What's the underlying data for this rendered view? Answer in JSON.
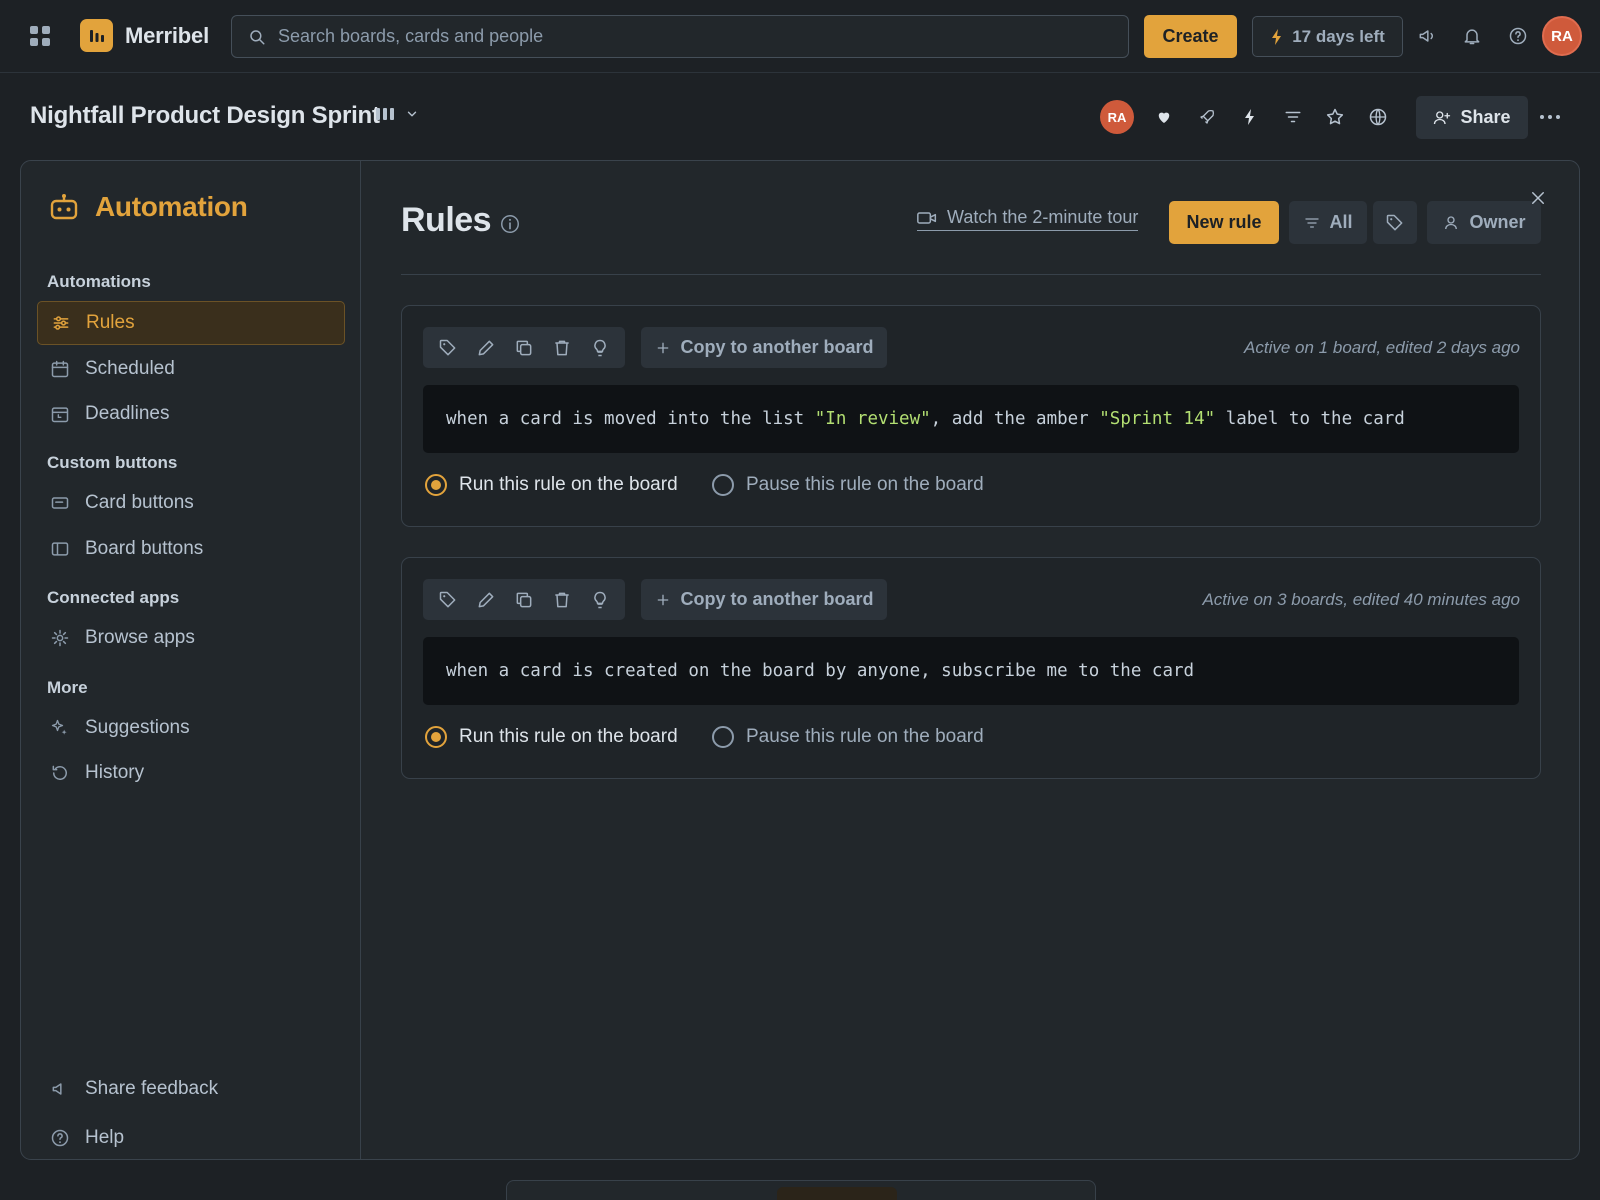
{
  "topbar": {
    "brand": "Merribel",
    "search_placeholder": "Search boards, cards and people",
    "create_label": "Create",
    "trial_label": "17 days left",
    "avatar_initials": "RA"
  },
  "board": {
    "title": "Nightfall Product Design Sprint",
    "avatar_initials": "RA",
    "share_label": "Share"
  },
  "sidebar": {
    "title": "Automation",
    "sections": [
      {
        "label": "Automations",
        "items": [
          {
            "label": "Rules",
            "icon": "sliders-icon",
            "active": true
          },
          {
            "label": "Scheduled",
            "icon": "calendar-icon"
          },
          {
            "label": "Deadlines",
            "icon": "calendar-clock-icon"
          }
        ]
      },
      {
        "label": "Custom buttons",
        "items": [
          {
            "label": "Card buttons",
            "icon": "card-icon"
          },
          {
            "label": "Board buttons",
            "icon": "board-icon"
          }
        ]
      },
      {
        "label": "Connected apps",
        "items": [
          {
            "label": "Browse apps",
            "icon": "gear-icon"
          }
        ]
      },
      {
        "label": "More",
        "items": [
          {
            "label": "Suggestions",
            "icon": "sparkle-icon"
          },
          {
            "label": "History",
            "icon": "history-icon"
          }
        ]
      }
    ],
    "footer": [
      {
        "label": "Share feedback",
        "icon": "megaphone-icon"
      },
      {
        "label": "Help",
        "icon": "help-icon"
      }
    ]
  },
  "main": {
    "title": "Rules",
    "tour_label": "Watch the 2-minute tour",
    "new_rule_label": "New rule",
    "filter_label": "All",
    "owner_label": "Owner",
    "rules": [
      {
        "copy_label": "Copy to another board",
        "meta": "Active on 1 board, edited 2 days ago",
        "code_parts": [
          "when a card is moved into the list ",
          "\"In review\"",
          ", add the amber ",
          "\"Sprint 14\"",
          " label to the card"
        ],
        "run_label": "Run this rule on the board",
        "pause_label": "Pause this rule on the board",
        "running": true
      },
      {
        "copy_label": "Copy to another board",
        "meta": "Active on 3 boards, edited 40 minutes ago",
        "code_parts": [
          "when a card is created on the board by anyone, subscribe me to the card"
        ],
        "run_label": "Run this rule on the board",
        "pause_label": "Pause this rule on the board",
        "running": true
      }
    ]
  },
  "colors": {
    "accent": "#e2a33c",
    "background": "#1d2125",
    "panel": "#22272b",
    "avatar": "#cf5a3b"
  }
}
